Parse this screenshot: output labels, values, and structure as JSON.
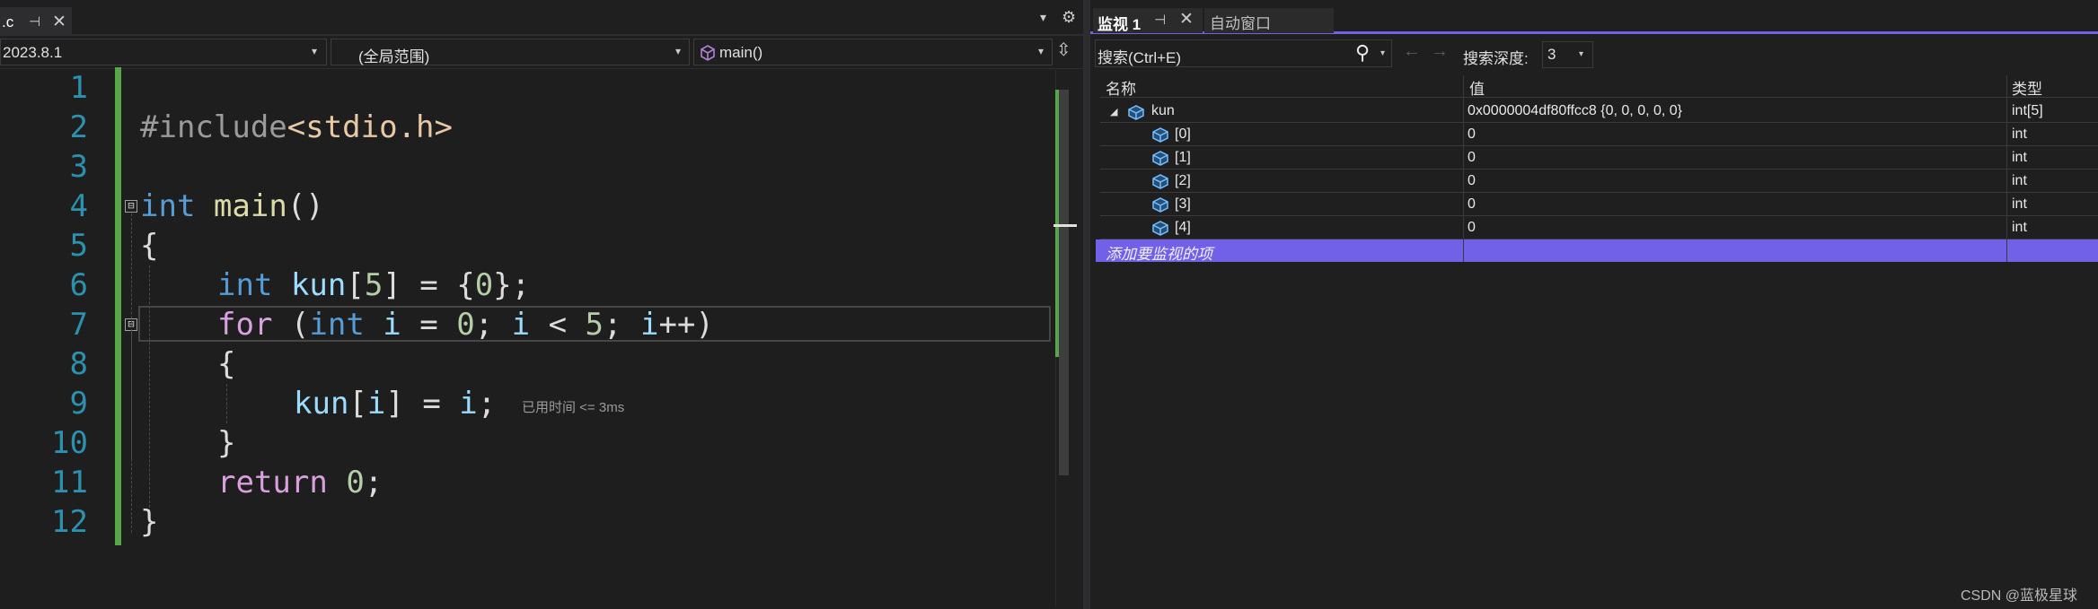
{
  "editor": {
    "file_tab": {
      "name": ".c",
      "pin": "⊣",
      "close": "✕"
    },
    "tab_dropdown": "▾",
    "tab_settings": "⚙",
    "nav": {
      "project": "2023.8.1",
      "scope": "(全局范围)",
      "function": "main()",
      "dropdown": "▾",
      "split": "⇳"
    },
    "line_numbers": [
      "1",
      "2",
      "3",
      "4",
      "5",
      "6",
      "7",
      "8",
      "9",
      "10",
      "11",
      "12"
    ],
    "code": {
      "l2_include": "#include",
      "l2_header": "<stdio.h>",
      "l4_type": "int",
      "l4_func": "main",
      "l4_parens": "()",
      "l5": "{",
      "l6_type": "int",
      "l6_var": "kun",
      "l6_open": "[",
      "l6_size": "5",
      "l6_close": "]",
      "l6_assign": " = ",
      "l6_init_open": "{",
      "l6_init_val": "0",
      "l6_init_close": "};",
      "l7_for": "for",
      "l7_open": " (",
      "l7_type": "int",
      "l7_var": "i",
      "l7_eq": " = ",
      "l7_zero": "0",
      "l7_semi1": "; ",
      "l7_var2": "i",
      "l7_lt": " < ",
      "l7_five": "5",
      "l7_semi2": "; ",
      "l7_var3": "i",
      "l7_inc": "++",
      "l7_close": ")",
      "l8": "{",
      "l9_var": "kun",
      "l9_open": "[",
      "l9_idx": "i",
      "l9_close": "]",
      "l9_eq": " = ",
      "l9_rhs": "i",
      "l9_semi": ";",
      "l10": "}",
      "l11_kw": "return",
      "l11_val": "0",
      "l11_semi": ";",
      "l12": "}"
    },
    "perf_tip": "已用时间 <= 3ms",
    "fold_marker": "⊟"
  },
  "watch": {
    "tab_label": "监视 1",
    "tab_pin": "⊣",
    "tab_close": "✕",
    "auto_tab_label": "自动窗口",
    "search_placeholder": "搜索(Ctrl+E)",
    "search_icon": "⚲",
    "search_drop": "▾",
    "back_arrow": "←",
    "forward_arrow": "→",
    "depth_label": "搜索深度:",
    "depth_value": "3",
    "depth_drop": "▾",
    "columns": {
      "name": "名称",
      "value": "值",
      "type": "类型"
    },
    "root": {
      "expander": "◢",
      "name": "kun",
      "value": "0x0000004df80ffcc8 {0, 0, 0, 0, 0}",
      "type": "int[5]"
    },
    "children": [
      {
        "name": "[0]",
        "value": "0",
        "type": "int"
      },
      {
        "name": "[1]",
        "value": "0",
        "type": "int"
      },
      {
        "name": "[2]",
        "value": "0",
        "type": "int"
      },
      {
        "name": "[3]",
        "value": "0",
        "type": "int"
      },
      {
        "name": "[4]",
        "value": "0",
        "type": "int"
      }
    ],
    "add_item": "添加要监视的项"
  },
  "watermark": "CSDN @蓝极星球",
  "colors": {
    "accent": "#7160e8",
    "change_bar": "#57a64a",
    "keyword": "#569cd6",
    "control": "#d8a0df",
    "function": "#dcdcaa",
    "variable": "#9cdcfe",
    "number": "#b5cea8",
    "line_number": "#2b91af"
  },
  "icons": {
    "object": "cube-icon"
  }
}
